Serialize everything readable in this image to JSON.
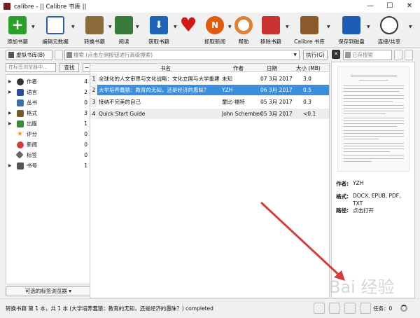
{
  "window": {
    "title": "calibre - || Calibre 书库 ||",
    "minimize": "—",
    "maximize": "☐",
    "close": "✕"
  },
  "toolbar": {
    "items": [
      {
        "label": "添加书籍",
        "color": "#2aa02a"
      },
      {
        "label": "编辑元数据",
        "color": "#2e5fa8"
      },
      {
        "label": "转换书籍",
        "color": "#8b6b3a"
      },
      {
        "label": "阅读",
        "color": "#3a7a3a"
      },
      {
        "label": "获取书籍",
        "color": "#1d63b8"
      },
      {
        "label": "",
        "color": "#d01818"
      },
      {
        "label": "抓取新闻",
        "color": "#e05a10"
      },
      {
        "label": "帮助",
        "color": "#e08030"
      },
      {
        "label": "移除书籍",
        "color": "#c83232"
      },
      {
        "label": "Calibre 书库",
        "color": "#8a5a2a"
      },
      {
        "label": "保存到磁盘",
        "color": "#1d5db8"
      },
      {
        "label": "连接/共享",
        "color": "#333333"
      }
    ]
  },
  "searchbar": {
    "virtual_library": "虚拟书库(B)",
    "search_placeholder": "搜索 (点击左侧按钮进行高级搜索)",
    "execute": "执行(G)",
    "saved_placeholder": "已存搜索"
  },
  "tag_browser": {
    "search_placeholder": "在标签浏览器中...",
    "find": "查找",
    "collapse": "−",
    "items": [
      {
        "label": "作者",
        "count": "4",
        "expandable": true,
        "icon": "author-icon",
        "color": "#333333"
      },
      {
        "label": "语言",
        "count": "2",
        "expandable": true,
        "icon": "language-icon",
        "color": "#2a4d9a"
      },
      {
        "label": "丛书",
        "count": "0",
        "expandable": false,
        "icon": "series-icon",
        "color": "#3a6fb0"
      },
      {
        "label": "格式",
        "count": "3",
        "expandable": true,
        "icon": "formats-icon",
        "color": "#7a5a2a"
      },
      {
        "label": "出版",
        "count": "1",
        "expandable": true,
        "icon": "publisher-icon",
        "color": "#3a8a3a"
      },
      {
        "label": "评分",
        "count": "0",
        "expandable": false,
        "icon": "rating-icon",
        "color": "#e0a020"
      },
      {
        "label": "新闻",
        "count": "0",
        "expandable": false,
        "icon": "news-icon",
        "color": "#d04040"
      },
      {
        "label": "标签",
        "count": "0",
        "expandable": false,
        "icon": "tags-icon",
        "color": "#666666"
      },
      {
        "label": "书号",
        "count": "1",
        "expandable": true,
        "icon": "identifiers-icon",
        "color": "#555555"
      }
    ],
    "bottom_button": "可选的标签浏览器"
  },
  "book_list": {
    "headers": {
      "title": "书名",
      "author": "作者",
      "date": "日期",
      "size": "大小 (MB)"
    },
    "rows": [
      {
        "num": "1",
        "title": "全球化的人文审思与文化战略：文化立国与大学重建",
        "author": "未知",
        "date": "07 3月 2017",
        "size": "3.0"
      },
      {
        "num": "2",
        "title": "大学培养蠢猿：教育的无知，还是经济的愚昧？",
        "author": "YZH",
        "date": "06 3月 2017",
        "size": "0.5",
        "selected": true
      },
      {
        "num": "3",
        "title": "接纳不完美的自己",
        "author": "童比-福特",
        "date": "05 3月 2017",
        "size": "0.3"
      },
      {
        "num": "4",
        "title": "Quick Start Guide",
        "author": "John Schember",
        "date": "05 3月 2017",
        "size": "<0.1",
        "gray": true
      }
    ]
  },
  "details": {
    "author_key": "作者:",
    "author_value": "YZH",
    "formats_key": "格式:",
    "formats_value_1": "DOCX, EPUB, PDF,",
    "formats_value_2": "TXT",
    "path_key": "路径:",
    "path_value": "点击打开"
  },
  "status": {
    "text": "转换书籍 第 1 本，共 1 本 (大学培养蠢猿：教育的无知，还是经济的愚昧？) completed",
    "jobs": "任务：0"
  },
  "watermark": "Bai 经验"
}
